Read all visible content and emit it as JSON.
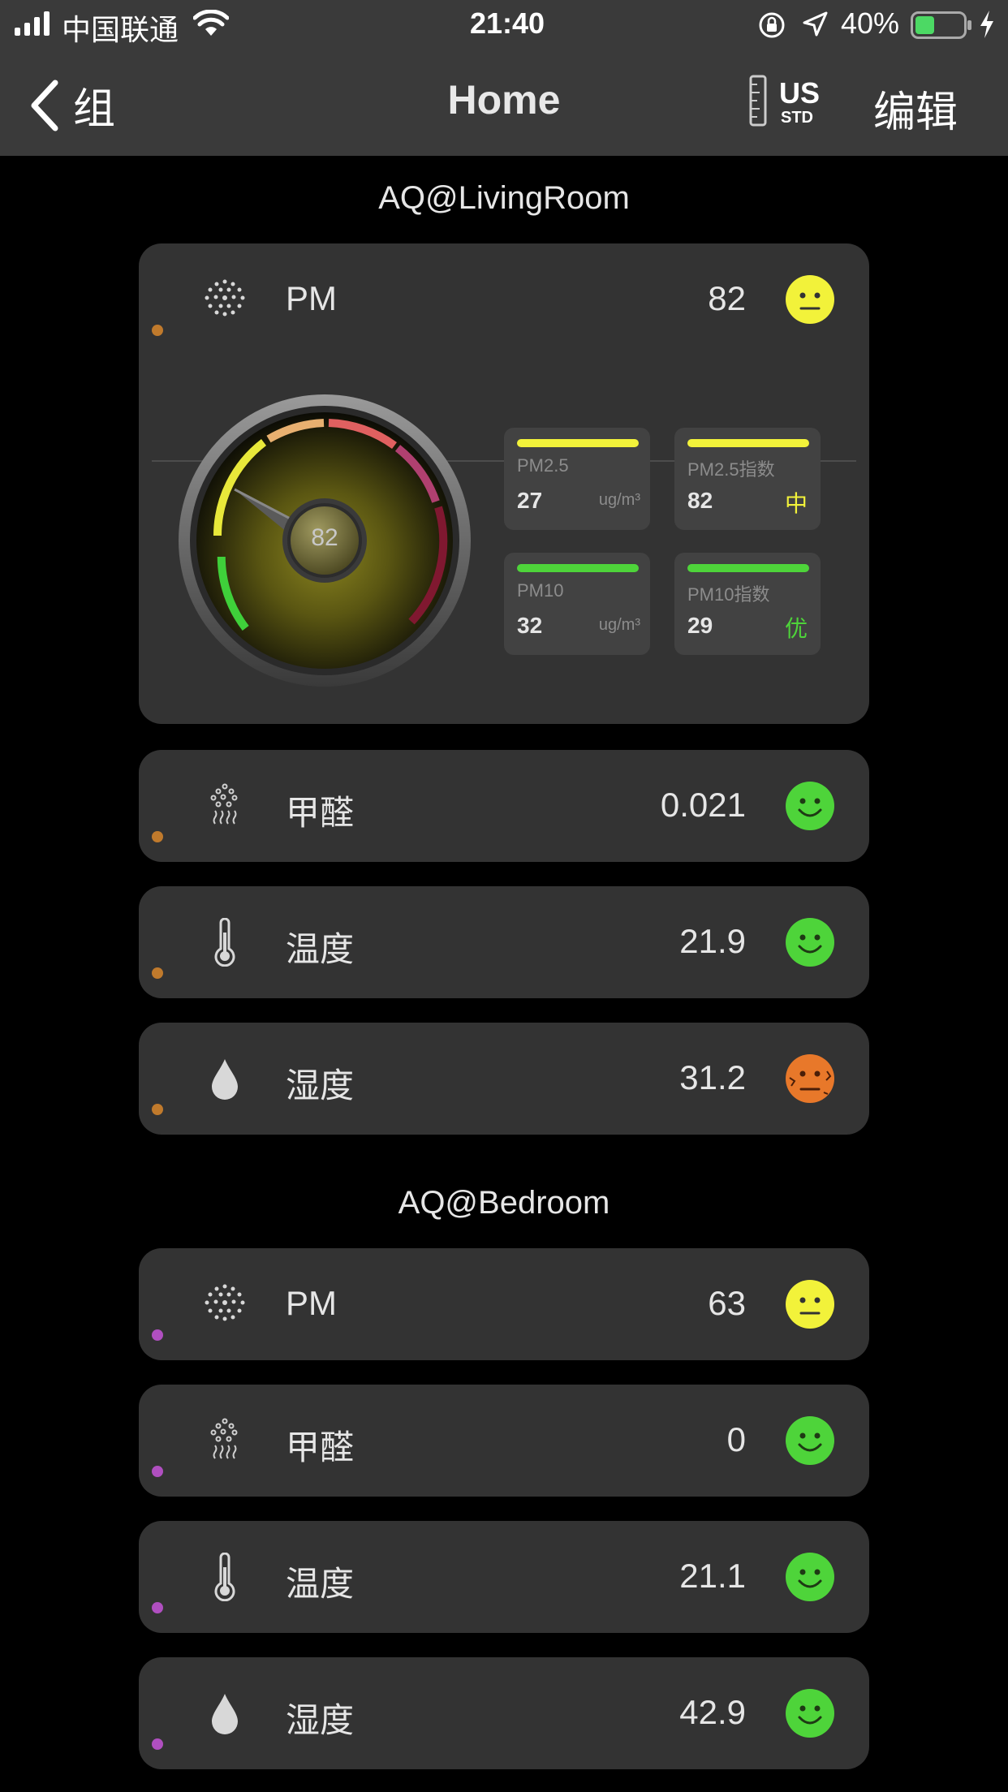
{
  "status_bar": {
    "carrier": "中国联通",
    "time": "21:40",
    "battery_percent": "40%",
    "battery_level": 0.4
  },
  "nav": {
    "back_label": "组",
    "title": "Home",
    "unit_badge_top": "US",
    "unit_badge_bottom": "STD",
    "edit_label": "编辑"
  },
  "groups": [
    {
      "title": "AQ@LivingRoom",
      "dot_color": "#c07a2c",
      "pm": {
        "label": "PM",
        "value": "82",
        "face": "neutral",
        "gauge_value": "82",
        "tiles": [
          {
            "name": "PM2.5",
            "value": "27",
            "unit": "ug/m³",
            "bar_color": "#f2f23a"
          },
          {
            "name": "PM2.5指数",
            "value": "82",
            "level": "中",
            "level_color": "#f2f23a",
            "bar_color": "#f2f23a"
          },
          {
            "name": "PM10",
            "value": "32",
            "unit": "ug/m³",
            "bar_color": "#4ed43a"
          },
          {
            "name": "PM10指数",
            "value": "29",
            "level": "优",
            "level_color": "#4ed43a",
            "bar_color": "#4ed43a"
          }
        ]
      },
      "rows": [
        {
          "label": "甲醛",
          "value": "0.021",
          "icon": "formaldehyde-icon",
          "face": "happy"
        },
        {
          "label": "温度",
          "value": "21.9",
          "icon": "thermometer-icon",
          "face": "happy"
        },
        {
          "label": "湿度",
          "value": "31.2",
          "icon": "water-drop-icon",
          "face": "dry"
        }
      ]
    },
    {
      "title": "AQ@Bedroom",
      "dot_color": "#b04fc0",
      "rows": [
        {
          "label": "PM",
          "value": "63",
          "icon": "particles-icon",
          "face": "neutral"
        },
        {
          "label": "甲醛",
          "value": "0",
          "icon": "formaldehyde-icon",
          "face": "happy"
        },
        {
          "label": "温度",
          "value": "21.1",
          "icon": "thermometer-icon",
          "face": "happy"
        },
        {
          "label": "湿度",
          "value": "42.9",
          "icon": "water-drop-icon",
          "face": "happy"
        }
      ]
    }
  ],
  "colors": {
    "good": "#4ed43a",
    "moderate": "#f2f23a",
    "dry": "#e8782a"
  }
}
